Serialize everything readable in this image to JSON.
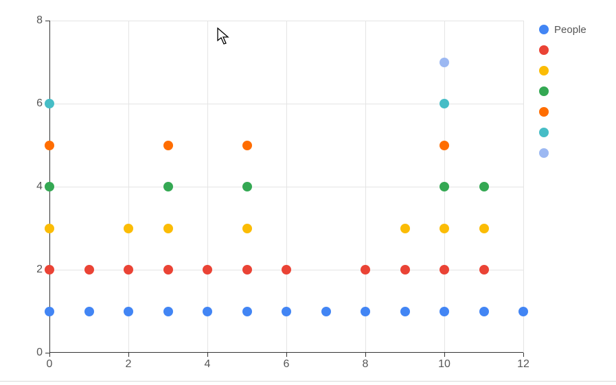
{
  "chart_data": {
    "type": "scatter",
    "xlim": [
      0,
      12
    ],
    "ylim": [
      0,
      8
    ],
    "x_ticks": [
      0,
      2,
      4,
      6,
      8,
      10,
      12
    ],
    "y_ticks": [
      0,
      2,
      4,
      6,
      8
    ],
    "series": [
      {
        "name": "People",
        "color": "#4285F4",
        "points": [
          {
            "x": 0,
            "y": 1
          },
          {
            "x": 1,
            "y": 1
          },
          {
            "x": 2,
            "y": 1
          },
          {
            "x": 3,
            "y": 1
          },
          {
            "x": 4,
            "y": 1
          },
          {
            "x": 5,
            "y": 1
          },
          {
            "x": 6,
            "y": 1
          },
          {
            "x": 7,
            "y": 1
          },
          {
            "x": 8,
            "y": 1
          },
          {
            "x": 9,
            "y": 1
          },
          {
            "x": 10,
            "y": 1
          },
          {
            "x": 11,
            "y": 1
          },
          {
            "x": 12,
            "y": 1
          }
        ]
      },
      {
        "name": "",
        "color": "#EA4335",
        "points": [
          {
            "x": 0,
            "y": 2
          },
          {
            "x": 1,
            "y": 2
          },
          {
            "x": 2,
            "y": 2
          },
          {
            "x": 3,
            "y": 2
          },
          {
            "x": 4,
            "y": 2
          },
          {
            "x": 5,
            "y": 2
          },
          {
            "x": 6,
            "y": 2
          },
          {
            "x": 8,
            "y": 2
          },
          {
            "x": 9,
            "y": 2
          },
          {
            "x": 10,
            "y": 2
          },
          {
            "x": 11,
            "y": 2
          }
        ]
      },
      {
        "name": "",
        "color": "#FBBC05",
        "points": [
          {
            "x": 0,
            "y": 3
          },
          {
            "x": 2,
            "y": 3
          },
          {
            "x": 3,
            "y": 3
          },
          {
            "x": 5,
            "y": 3
          },
          {
            "x": 9,
            "y": 3
          },
          {
            "x": 10,
            "y": 3
          },
          {
            "x": 11,
            "y": 3
          }
        ]
      },
      {
        "name": "",
        "color": "#34A853",
        "points": [
          {
            "x": 0,
            "y": 4
          },
          {
            "x": 3,
            "y": 4
          },
          {
            "x": 5,
            "y": 4
          },
          {
            "x": 10,
            "y": 4
          },
          {
            "x": 11,
            "y": 4
          }
        ]
      },
      {
        "name": "",
        "color": "#FF6D00",
        "points": [
          {
            "x": 0,
            "y": 5
          },
          {
            "x": 3,
            "y": 5
          },
          {
            "x": 5,
            "y": 5
          },
          {
            "x": 10,
            "y": 5
          }
        ]
      },
      {
        "name": "",
        "color": "#46BDC6",
        "points": [
          {
            "x": 0,
            "y": 6
          },
          {
            "x": 10,
            "y": 6
          }
        ]
      },
      {
        "name": "",
        "color": "#9CB8F2",
        "points": [
          {
            "x": 10,
            "y": 7
          }
        ]
      }
    ]
  }
}
